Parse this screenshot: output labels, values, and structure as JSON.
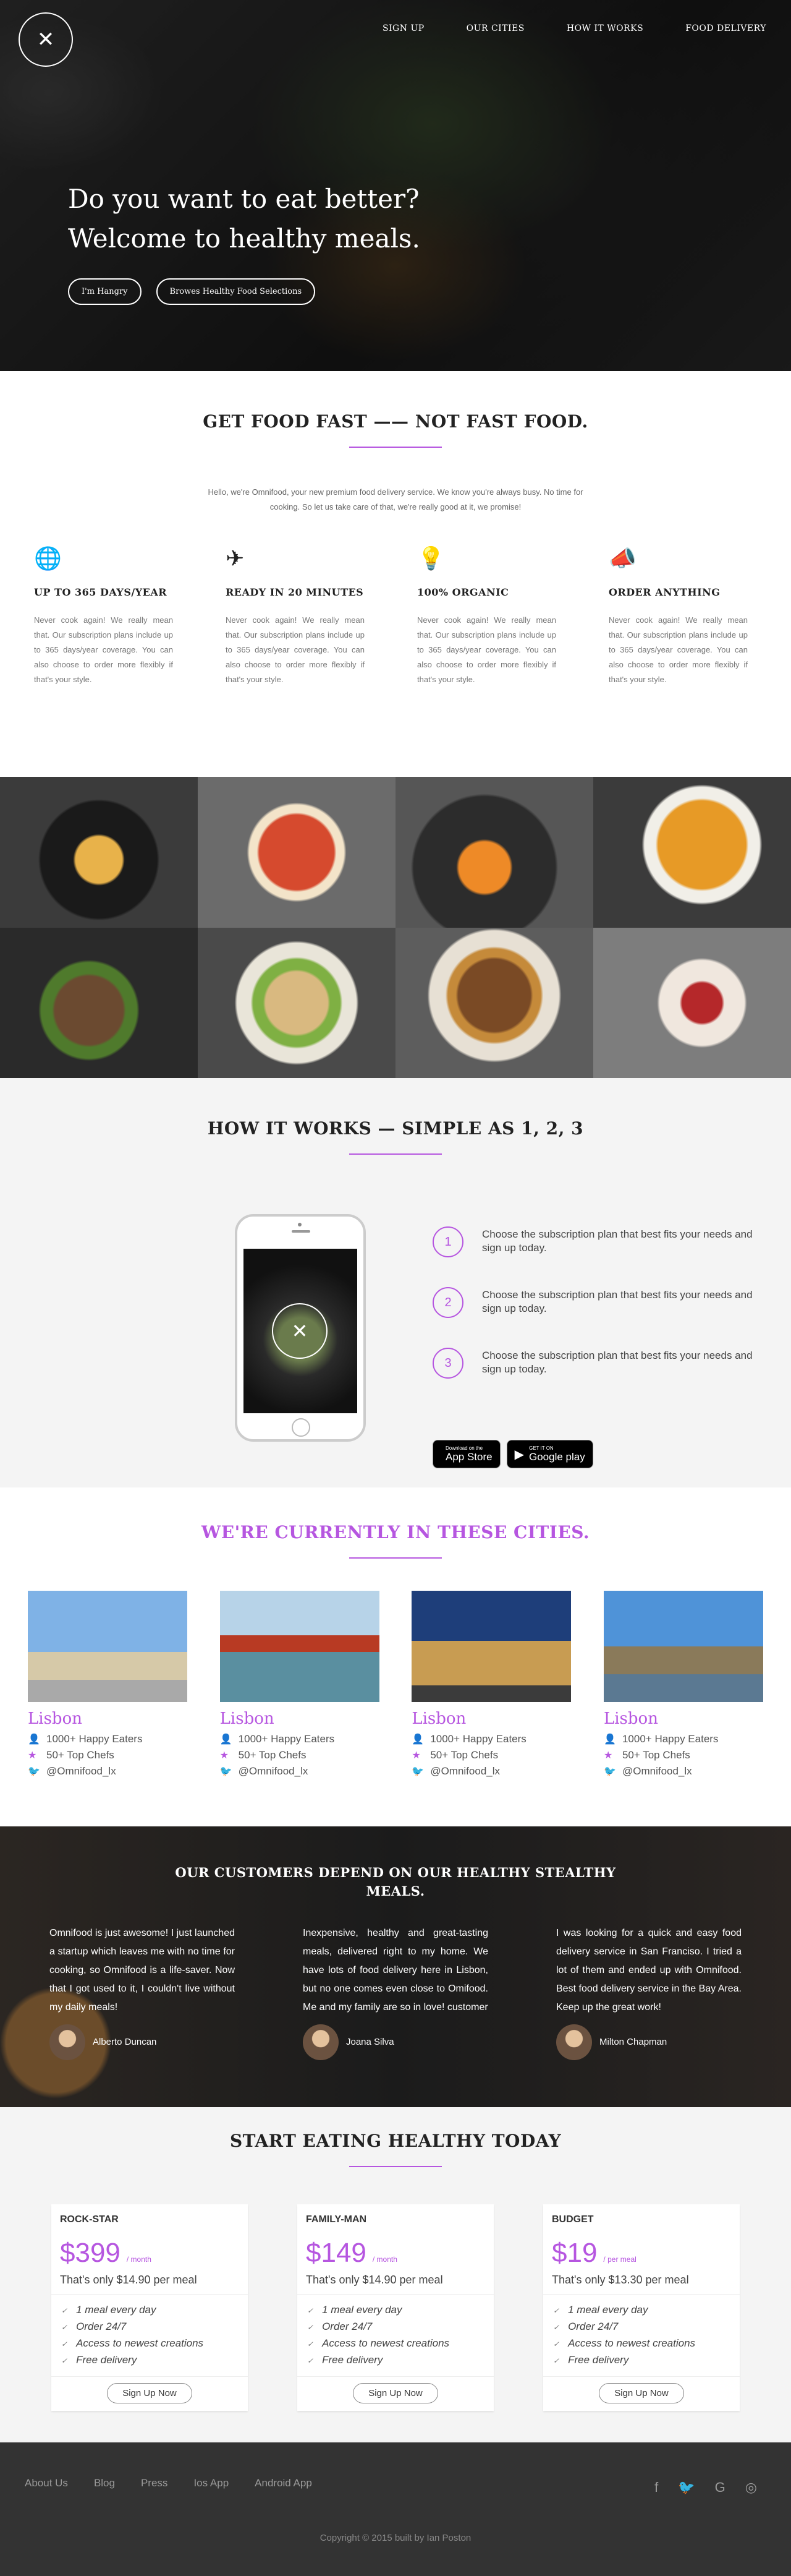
{
  "nav": {
    "items": [
      "SIGN UP",
      "OUR CITIES",
      "HOW IT WORKS",
      "FOOD DELIVERY"
    ]
  },
  "hero": {
    "title_line1": "Do you want to eat better?",
    "title_line2": "Welcome to healthy meals.",
    "btn_hungry": "I'm Hangry",
    "btn_browse": "Browes Healthy Food Selections"
  },
  "features": {
    "title": "GET FOOD FAST —— NOT FAST FOOD.",
    "intro": "Hello, we're Omnifood, your new premium food delivery service. We know you're always busy. No time for cooking. So let us take care of that, we're really good at it, we promise!",
    "items": [
      {
        "icon": "globe-icon",
        "heading": "UP TO 365 DAYS/YEAR",
        "text": "Never cook again! We really mean that. Our subscription plans include up to 365 days/year coverage. You can also choose to order more flexibly if that's your style."
      },
      {
        "icon": "airplane-icon",
        "heading": "READY IN 20 MINUTES",
        "text": "Never cook again! We really mean that. Our subscription plans include up to 365 days/year coverage. You can also choose to order more flexibly if that's your style."
      },
      {
        "icon": "lightbulb-icon",
        "heading": "100% ORGANIC",
        "text": "Never cook again! We really mean that. Our subscription plans include up to 365 days/year coverage. You can also choose to order more flexibly if that's your style."
      },
      {
        "icon": "megaphone-icon",
        "heading": "ORDER ANYTHING",
        "text": "Never cook again! We really mean that. Our subscription plans include up to 365 days/year coverage. You can also choose to order more flexibly if that's your style."
      }
    ]
  },
  "how": {
    "title": "HOW IT WORKS — SIMPLE AS 1, 2, 3",
    "steps": [
      {
        "num": "1",
        "text": "Choose the subscription plan that best fits your needs and sign up today."
      },
      {
        "num": "2",
        "text": "Choose the subscription plan that best fits your needs and sign up today."
      },
      {
        "num": "3",
        "text": "Choose the subscription plan that best fits your needs and sign up today."
      }
    ],
    "appstore_small": "Download on the",
    "appstore_big": "App Store",
    "googleplay_small": "GET IT ON",
    "googleplay_big": "Google play"
  },
  "cities": {
    "title": "WE'RE CURRENTLY IN THESE CITIES.",
    "items": [
      {
        "name": "Lisbon",
        "eaters": "1000+ Happy Eaters",
        "chefs": "50+ Top Chefs",
        "twitter": "@Omnifood_lx"
      },
      {
        "name": "Lisbon",
        "eaters": "1000+ Happy Eaters",
        "chefs": "50+ Top Chefs",
        "twitter": "@Omnifood_lx"
      },
      {
        "name": "Lisbon",
        "eaters": "1000+ Happy Eaters",
        "chefs": "50+ Top Chefs",
        "twitter": "@Omnifood_lx"
      },
      {
        "name": "Lisbon",
        "eaters": "1000+ Happy Eaters",
        "chefs": "50+ Top Chefs",
        "twitter": "@Omnifood_lx"
      }
    ]
  },
  "testimonials": {
    "title": "OUR CUSTOMERS DEPEND ON OUR HEALTHY STEALTHY MEALS.",
    "items": [
      {
        "quote": "Omnifood is just awesome! I just launched a startup which leaves me with no time for cooking, so Omnifood is a life-saver. Now that I got used to it, I couldn't live without my daily meals!",
        "name": "Alberto Duncan"
      },
      {
        "quote": "Inexpensive, healthy and great-tasting meals, delivered right to my home. We have lots of food delivery here in Lisbon, but no one comes even close to Omifood. Me and my family are so in love! customer",
        "name": "Joana Silva"
      },
      {
        "quote": "I was looking for a quick and easy food delivery service in San Franciso. I tried a lot of them and ended up with Omnifood. Best food delivery service in the Bay Area. Keep up the great work!",
        "name": "Milton Chapman"
      }
    ]
  },
  "pricing": {
    "title": "START EATING HEALTHY TODAY",
    "plans": [
      {
        "name": "ROCK-STAR",
        "price": "$399",
        "unit": "/ month",
        "sub": "That's only $14.90 per meal",
        "features": [
          "1 meal every day",
          "Order 24/7",
          "Access to newest creations",
          "Free delivery"
        ],
        "button": "Sign Up Now"
      },
      {
        "name": "FAMILY-MAN",
        "price": "$149",
        "unit": "/ month",
        "sub": "That's only $14.90 per meal",
        "features": [
          "1 meal every day",
          "Order 24/7",
          "Access to newest creations",
          "Free delivery"
        ],
        "button": "Sign Up Now"
      },
      {
        "name": "BUDGET",
        "price": "$19",
        "unit": "/ per meal",
        "sub": "That's only $13.30 per meal",
        "features": [
          "1 meal every day",
          "Order 24/7",
          "Access to newest creations",
          "Free delivery"
        ],
        "button": "Sign Up Now"
      }
    ]
  },
  "footer": {
    "links": [
      "About Us",
      "Blog",
      "Press",
      "Ios App",
      "Android App"
    ],
    "copyright": "Copyright © 2015 built by Ian Poston"
  },
  "colors": {
    "accent": "#b656e0",
    "footer_bg": "#333333",
    "light_bg": "#f4f4f4"
  }
}
